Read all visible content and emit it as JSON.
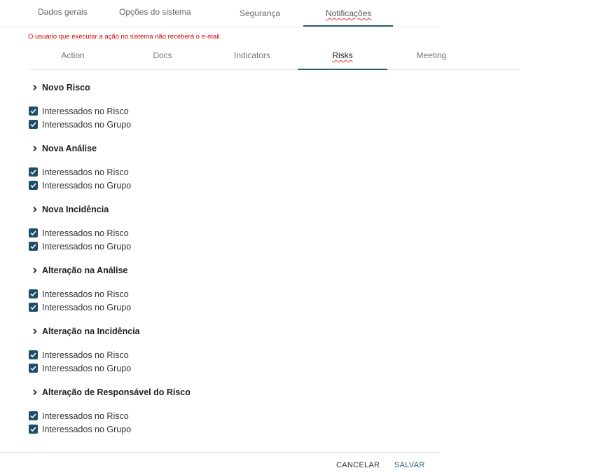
{
  "top_tabs": [
    {
      "label": "Dados gerais"
    },
    {
      "label": "Opções do sistema"
    },
    {
      "label": "Segurança"
    },
    {
      "label": "Notificações"
    }
  ],
  "warning": "O usuário que executar a ação no sistema não receberá o e-mail.",
  "sub_tabs": [
    {
      "label": "Action"
    },
    {
      "label": "Docs"
    },
    {
      "label": "Indicators"
    },
    {
      "label": "Risks"
    },
    {
      "label": "Meeting"
    }
  ],
  "sections": [
    {
      "title": "Novo Risco",
      "options": [
        {
          "label": "Interessados no Risco",
          "checked": true
        },
        {
          "label": "Interessados no Grupo",
          "checked": true
        }
      ]
    },
    {
      "title": "Nova Análise",
      "options": [
        {
          "label": "Interessados no Risco",
          "checked": true
        },
        {
          "label": "Interessados no Grupo",
          "checked": true
        }
      ]
    },
    {
      "title": "Nova Incidência",
      "options": [
        {
          "label": "Interessados no Risco",
          "checked": true
        },
        {
          "label": "Interessados no Grupo",
          "checked": true
        }
      ]
    },
    {
      "title": "Alteração na Análise",
      "options": [
        {
          "label": "Interessados no Risco",
          "checked": true
        },
        {
          "label": "Interessados no Grupo",
          "checked": true
        }
      ]
    },
    {
      "title": "Alteração na Incidência",
      "options": [
        {
          "label": "Interessados no Risco",
          "checked": true
        },
        {
          "label": "Interessados no Grupo",
          "checked": true
        }
      ]
    },
    {
      "title": "Alteração de Responsável do Risco",
      "options": [
        {
          "label": "Interessados no Risco",
          "checked": true
        },
        {
          "label": "Interessados no Grupo",
          "checked": true
        }
      ]
    }
  ],
  "footer": {
    "cancel_label": "CANCELAR",
    "save_label": "SALVAR"
  },
  "colors": {
    "accent": "#2f5d73",
    "checkbox": "#1f4e6b",
    "warning": "#d50000"
  },
  "icons": {
    "section_toggle": "chevron-right-icon",
    "checkbox_mark": "checkmark-icon"
  }
}
